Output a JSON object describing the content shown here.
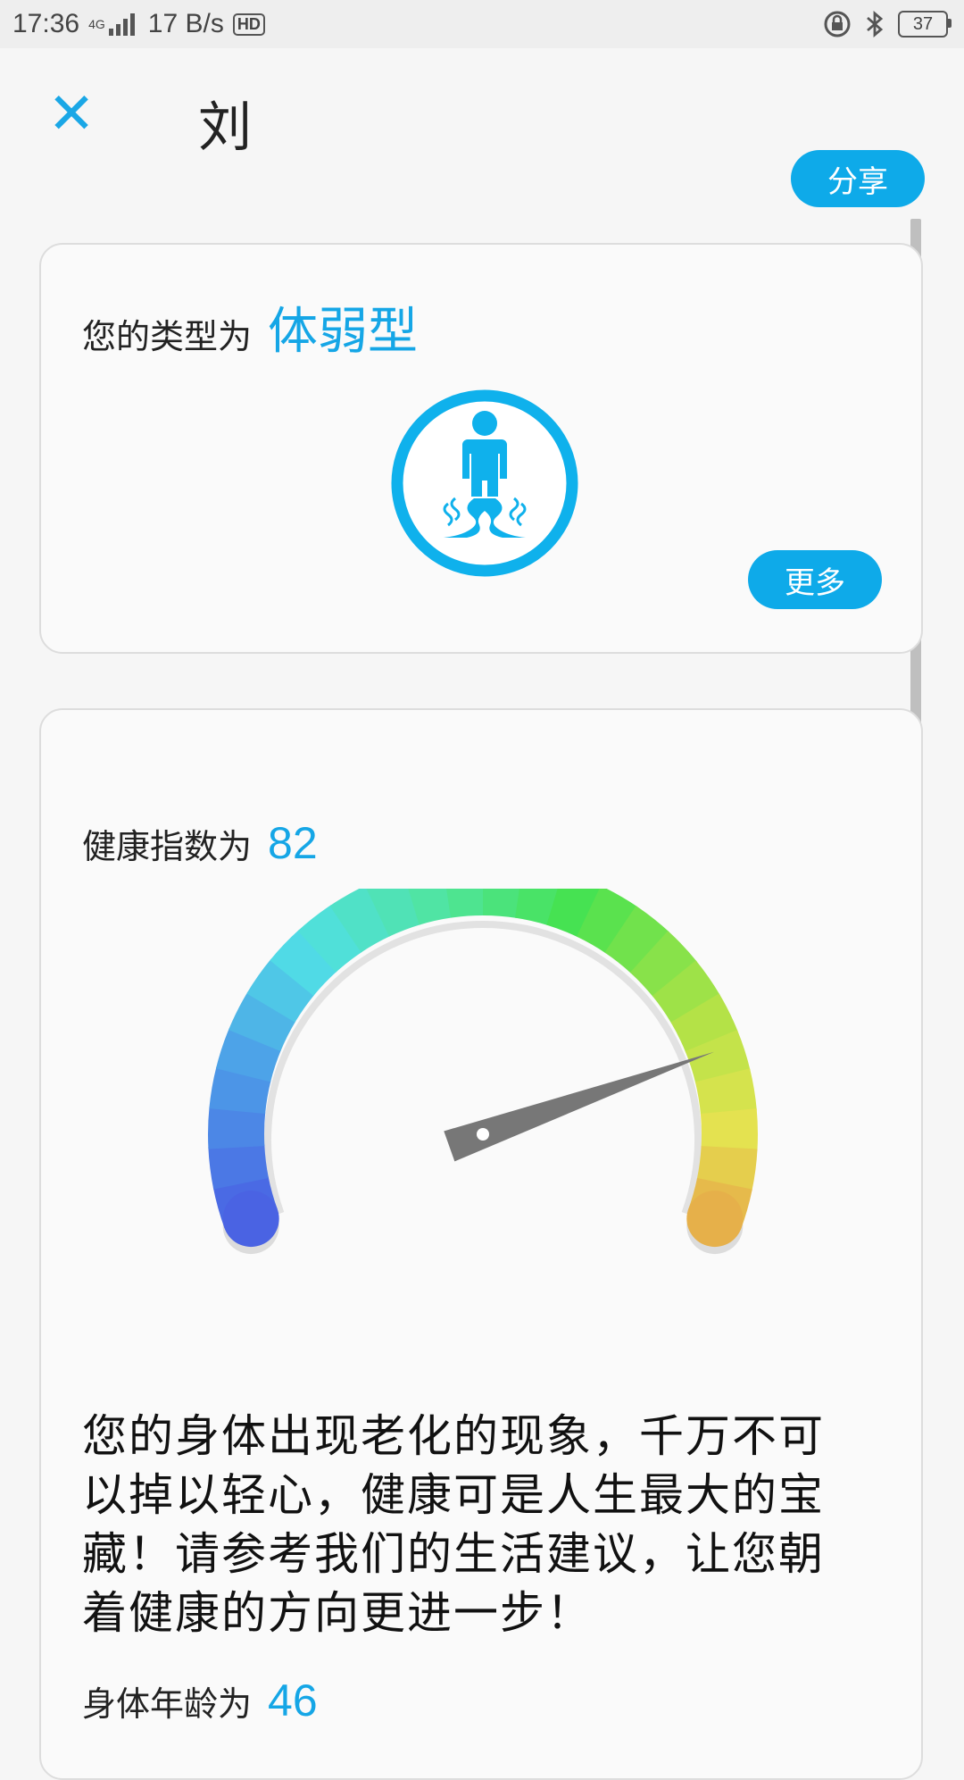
{
  "status_bar": {
    "time": "17:36",
    "network_label": "4G",
    "speed": "17 B/s",
    "hd_label": "HD",
    "battery": "37"
  },
  "header": {
    "title": "刘",
    "share_label": "分享"
  },
  "type_card": {
    "label": "您的类型为",
    "type_value": "体弱型",
    "more_label": "更多"
  },
  "health_card": {
    "index_label": "健康指数为",
    "index_value": "82",
    "gauge_level": 82,
    "description": "您的身体出现老化的现象，千万不可以掉以轻心，健康可是人生最大的宝藏！请参考我们的生活建议，让您朝着健康的方向更进一步！",
    "age_label": "身体年龄为",
    "age_value": "46"
  },
  "colors": {
    "accent": "#0eaae9",
    "gauge_start": "#4a63e3",
    "gauge_mid": "#46e35a",
    "gauge_end": "#e6b04a",
    "needle": "#777777"
  },
  "icons": [
    "close-icon",
    "weak-body-icon",
    "bluetooth-icon",
    "lock-rotation-icon",
    "signal-icon"
  ]
}
